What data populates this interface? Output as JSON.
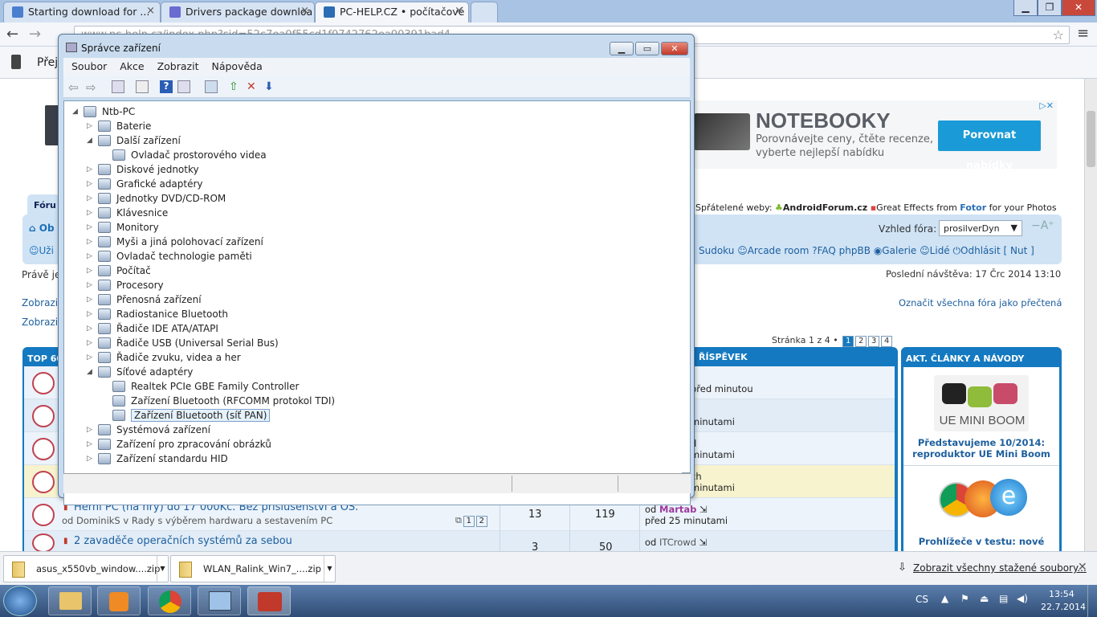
{
  "browser": {
    "tabs": [
      {
        "title": "Starting download for ..."
      },
      {
        "title": "Drivers package downloa"
      },
      {
        "title": "PC-HELP.CZ • počítačové"
      }
    ],
    "url": "www.pc-help.cz/index.php?sid=52c7ea0f55cd1f0742762ea00391bad4",
    "bookmark_partial": "Přej"
  },
  "ad": {
    "title": "NOTEBOOKY",
    "text": "Porovnávejte ceny, čtěte recenze, vyberte nejlepší nabídku",
    "button": "Porovnat nabídky",
    "adchoices": "▷✕"
  },
  "forum": {
    "friendly_sites_label": "Spřátelené weby:",
    "friendly_site_1": "AndroidForum.cz",
    "friendly_site_2_pre": "Great Effects from",
    "friendly_site_2_brand": "Fotor",
    "friendly_site_2_post": "for your Photos",
    "style_label": "Vzhled fóra:",
    "style_value": "prosilverDyn",
    "tab_partial": "Fóru",
    "nav_partial_1": "Ob",
    "nav_partial_2": "Uži",
    "nav_links": [
      "Sudoku",
      "Arcade room",
      "FAQ phpBB",
      "Galerie",
      "Lidé",
      "Odhlásit [ Nut ]"
    ],
    "pravje_partial": "Právě je",
    "last_visit": "Poslední návštěva: 17 Črc 2014 13:10",
    "zobrazit_1": "Zobrazi",
    "zobrazit_2": "Zobrazi",
    "mark_read": "Označit všechna fóra jako přečtená",
    "pagination_label": "Stránka 1 z 4 •",
    "pages": [
      "1",
      "2",
      "3",
      "4"
    ],
    "top_header": "TOP 60",
    "last_post_header": "ŘÍSPĚVEK",
    "articles_header": "AKT. ČLÁNKY A NÁVODY",
    "article_1_img_text": "UE MINI BOOM",
    "article_1": "Představujeme 10/2014: reproduktor UE Mini Boom",
    "article_2": "Prohlížeče v testu: nové",
    "partial_rows": [
      {
        "line1": "",
        "line2": "před minutou"
      },
      {
        "line1": "",
        "line2": "minutami"
      },
      {
        "line1": "d",
        "line2": "minutami"
      },
      {
        "line1": "ch",
        "line2": "minutami"
      }
    ],
    "topics": [
      {
        "title": "Herní PC (na hry) do 17 000Kč. Bez příslušenství a OS.",
        "sub": "od DominikS v Rady s výběrem hardwaru a sestavením PC",
        "pages": [
          "1",
          "2"
        ],
        "replies": "13",
        "views": "119",
        "last_prefix": "od",
        "last_user": "Martab",
        "last_time": "před 25 minutami"
      },
      {
        "title": "2 zavaděče operačních systémů za sebou",
        "sub": "",
        "replies": "3",
        "views": "50",
        "last_prefix": "od",
        "last_user": "ITCrowd",
        "last_time": ""
      }
    ]
  },
  "device_manager": {
    "title": "Správce zařízení",
    "menu": [
      "Soubor",
      "Akce",
      "Zobrazit",
      "Nápověda"
    ],
    "tree": [
      {
        "label": "Ntb-PC",
        "level": 0,
        "exp": "◢"
      },
      {
        "label": "Baterie",
        "level": 1,
        "exp": "▷"
      },
      {
        "label": "Další zařízení",
        "level": 1,
        "exp": "◢"
      },
      {
        "label": "Ovladač prostorového videa",
        "level": 2,
        "exp": ""
      },
      {
        "label": "Diskové jednotky",
        "level": 1,
        "exp": "▷"
      },
      {
        "label": "Grafické adaptéry",
        "level": 1,
        "exp": "▷"
      },
      {
        "label": "Jednotky DVD/CD-ROM",
        "level": 1,
        "exp": "▷"
      },
      {
        "label": "Klávesnice",
        "level": 1,
        "exp": "▷"
      },
      {
        "label": "Monitory",
        "level": 1,
        "exp": "▷"
      },
      {
        "label": "Myši a jiná polohovací zařízení",
        "level": 1,
        "exp": "▷"
      },
      {
        "label": "Ovladač technologie paměti",
        "level": 1,
        "exp": "▷"
      },
      {
        "label": "Počítač",
        "level": 1,
        "exp": "▷"
      },
      {
        "label": "Procesory",
        "level": 1,
        "exp": "▷"
      },
      {
        "label": "Přenosná zařízení",
        "level": 1,
        "exp": "▷"
      },
      {
        "label": "Radiostanice Bluetooth",
        "level": 1,
        "exp": "▷"
      },
      {
        "label": "Řadiče IDE ATA/ATAPI",
        "level": 1,
        "exp": "▷"
      },
      {
        "label": "Řadiče USB (Universal Serial Bus)",
        "level": 1,
        "exp": "▷"
      },
      {
        "label": "Řadiče zvuku, videa a her",
        "level": 1,
        "exp": "▷"
      },
      {
        "label": "Síťové adaptéry",
        "level": 1,
        "exp": "◢"
      },
      {
        "label": "Realtek PCIe GBE Family Controller",
        "level": 2,
        "exp": ""
      },
      {
        "label": "Zařízení Bluetooth (RFCOMM protokol TDI)",
        "level": 2,
        "exp": ""
      },
      {
        "label": "Zařízení Bluetooth (síť PAN)",
        "level": 2,
        "exp": "",
        "selected": true
      },
      {
        "label": "Systémová zařízení",
        "level": 1,
        "exp": "▷"
      },
      {
        "label": "Zařízení pro zpracování obrázků",
        "level": 1,
        "exp": "▷"
      },
      {
        "label": "Zařízení standardu HID",
        "level": 1,
        "exp": "▷"
      }
    ]
  },
  "downloads": {
    "items": [
      "asus_x550vb_window....zip",
      "WLAN_Ralink_Win7_....zip"
    ],
    "show_all": "Zobrazit všechny stažené soubory..."
  },
  "taskbar": {
    "lang": "CS",
    "time": "13:54",
    "date": "22.7.2014"
  },
  "colors": {
    "accent": "#1479c0",
    "taskbar": "#3b5f8f",
    "ad_button": "#1a9bd7"
  }
}
